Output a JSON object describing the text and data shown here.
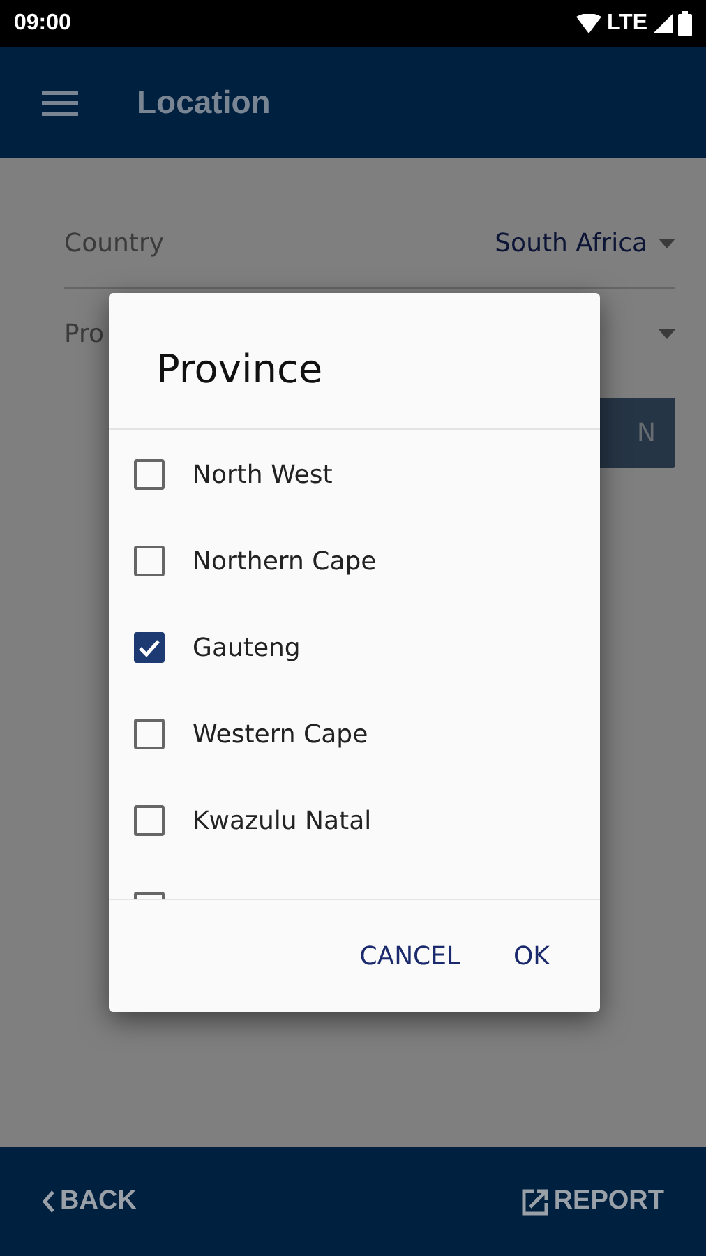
{
  "status_bar": {
    "time": "09:00",
    "network": "LTE"
  },
  "app_bar": {
    "title": "Location"
  },
  "form": {
    "country_label": "Country",
    "country_value": "South Africa",
    "province_label": "Pro",
    "button_label": "N"
  },
  "dialog": {
    "title": "Province",
    "items": [
      {
        "label": "North West",
        "checked": false
      },
      {
        "label": "Northern Cape",
        "checked": false
      },
      {
        "label": "Gauteng",
        "checked": true
      },
      {
        "label": "Western Cape",
        "checked": false
      },
      {
        "label": "Kwazulu Natal",
        "checked": false
      },
      {
        "checked": false
      }
    ],
    "buttons": [
      "CANCEL",
      "OK"
    ]
  },
  "bottom_bar": {
    "back": "BACK",
    "report": "REPORT"
  }
}
